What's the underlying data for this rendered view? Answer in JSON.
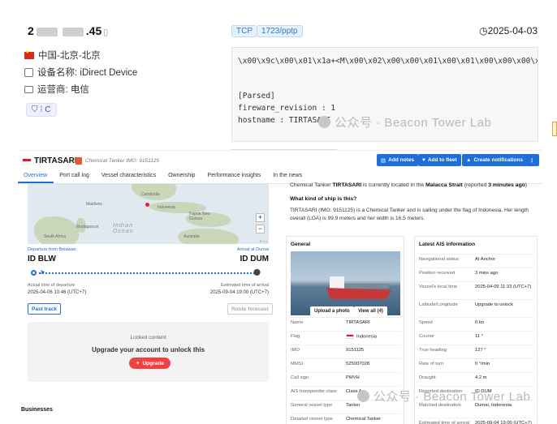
{
  "host": {
    "ip_start": "2",
    "ip_end": ".45",
    "location": "中国-北京-北京",
    "device": "设备名称: iDirect Device",
    "operator": "运营商: 电信",
    "protocol_chip": "C",
    "tags": [
      "TCP",
      "1723/pptp"
    ],
    "date": "2025-04-03",
    "banner_raw": "\\x00\\x9c\\x00\\x01\\x1a+<M\\x00\\x02\\x00\\x00\\x01\\x00\\x01\\x00\\x00\\x00\\x00\\x0",
    "parsed_header": "[Parsed]",
    "firmware_line": "fireware_revision : 1",
    "hostname_line": "hostname : TIRTASARI"
  },
  "watermark": "公众号 · Beacon Tower Lab",
  "vessel": {
    "name": "TIRTASARI",
    "subtitle": "Chemical Tanker  IMO: 9151125",
    "header_buttons": [
      "Add notes",
      "Add to fleet",
      "Create notifications"
    ],
    "tabs": [
      "Overview",
      "Port call log",
      "Vessel characteristics",
      "Ownership",
      "Performance insights",
      "In the news"
    ],
    "map_labels": {
      "cambodia": "Cambodia",
      "maldives": "Maldives",
      "indonesia": "Indonesia",
      "madagascar": "Madagascar",
      "ocean": "Indian\nOcean",
      "png": "Papua New\nGuinea",
      "south_africa": "South Africa",
      "australia": "Australia"
    },
    "departure_label": "Departure from Belawan",
    "arrival_label": "Arrival at Dumai",
    "from_port": "ID BLW",
    "to_port": "ID DUM",
    "atd_label": "Actual time of departure",
    "atd_value": "2025-04-06 10:46 (UTC+7)",
    "eta_label": "Estimated time of arrival",
    "eta_value": "2025-09-04 19:00 (UTC+7)",
    "past_track": "Past track",
    "route_forecast": "Route forecast",
    "locked_title": "Locked content",
    "locked_msg": "Upgrade your account to unlock this",
    "upgrade": "Upgrade",
    "businesses": "Businesses",
    "summary": {
      "prefix": "Chemical Tanker ",
      "name": "TIRTASARI",
      "mid": " is currently located in the ",
      "area": "Malacca Strait",
      "mid2": " (reported ",
      "ago": "3 minutes ago",
      "end": ")"
    },
    "what_kind": "What kind of ship is this?",
    "desc_line": "TIRTASARI (IMO: 9151125) is a Chemical Tanker and is sailing under the flag of Indonesia. Her length overall (LOA) is 99.9 meters and her width is 16.5 meters.",
    "general": {
      "title": "General",
      "upload": "Upload a photo",
      "view_all": "View all (4)",
      "rows": [
        {
          "k": "Name",
          "v": "TIRTASARI"
        },
        {
          "k": "Flag",
          "v": "Indonesia"
        },
        {
          "k": "IMO",
          "v": "9151125"
        },
        {
          "k": "MMSI",
          "v": "525007028"
        },
        {
          "k": "Call sign",
          "v": "PMVH"
        },
        {
          "k": "AIS transponder class",
          "v": "Class A"
        },
        {
          "k": "General vessel type",
          "v": "Tanker"
        },
        {
          "k": "Detailed vessel type",
          "v": "Chemical Tanker"
        }
      ]
    },
    "ais": {
      "title": "Latest AIS information",
      "rows": [
        {
          "k": "Navigational status",
          "v": "At Anchor"
        },
        {
          "k": "Position received",
          "v": "3 mins ago"
        },
        {
          "k": "Vessel's local time",
          "v": "2025-04-09 11:33 (UTC+7)"
        },
        {
          "k": "Latitude/Longitude",
          "v": "Upgrade to unlock"
        },
        {
          "k": "Speed",
          "v": "0 kn"
        },
        {
          "k": "Course",
          "v": "11 °"
        },
        {
          "k": "True heading",
          "v": "127 °"
        },
        {
          "k": "Rate of turn",
          "v": "0 °/min"
        },
        {
          "k": "Draught",
          "v": "4.2 m"
        },
        {
          "k": "Reported destination",
          "v": "ID DUM"
        },
        {
          "k": "Matched destination",
          "v": "Dumai, Indonesia"
        },
        {
          "k": "Estimated time of arrival",
          "v": "2025-09-04 19:00 (UTC+7)"
        }
      ]
    }
  }
}
